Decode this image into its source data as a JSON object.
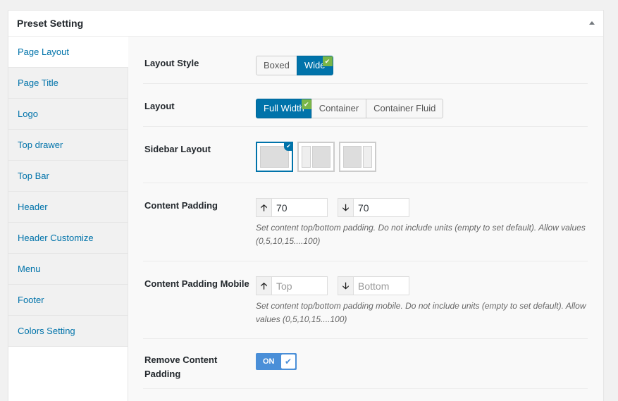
{
  "panel": {
    "title": "Preset Setting",
    "collapse_icon": "triangle-up-icon"
  },
  "tabs": [
    {
      "label": "Page Layout",
      "active": true
    },
    {
      "label": "Page Title"
    },
    {
      "label": "Logo"
    },
    {
      "label": "Top drawer"
    },
    {
      "label": "Top Bar"
    },
    {
      "label": "Header"
    },
    {
      "label": "Header Customize"
    },
    {
      "label": "Menu"
    },
    {
      "label": "Footer"
    },
    {
      "label": "Colors Setting"
    }
  ],
  "settings": {
    "layout_style": {
      "label": "Layout Style",
      "options": [
        "Boxed",
        "Wide"
      ],
      "selected": "Wide"
    },
    "layout": {
      "label": "Layout",
      "options": [
        "Full Width",
        "Container",
        "Container Fluid"
      ],
      "selected": "Full Width"
    },
    "sidebar_layout": {
      "label": "Sidebar Layout",
      "options": [
        "no-sidebar",
        "left-sidebar",
        "right-sidebar"
      ],
      "selected": "no-sidebar"
    },
    "content_padding": {
      "label": "Content Padding",
      "top_value": "70",
      "bottom_value": "70",
      "top_icon": "arrow-up-icon",
      "bottom_icon": "arrow-down-icon",
      "description": "Set content top/bottom padding. Do not include units (empty to set default). Allow values (0,5,10,15....100)"
    },
    "content_padding_mobile": {
      "label": "Content Padding Mobile",
      "top_placeholder": "Top",
      "bottom_placeholder": "Bottom",
      "description": "Set content top/bottom padding mobile. Do not include units (empty to set default). Allow values (0,5,10,15....100)"
    },
    "remove_content_padding": {
      "label": "Remove Content Padding",
      "state": "ON"
    }
  },
  "colors": {
    "accent": "#0073aa",
    "check_green": "#7ab648",
    "toggle_blue": "#4a8fd8",
    "link": "#0073aa"
  }
}
